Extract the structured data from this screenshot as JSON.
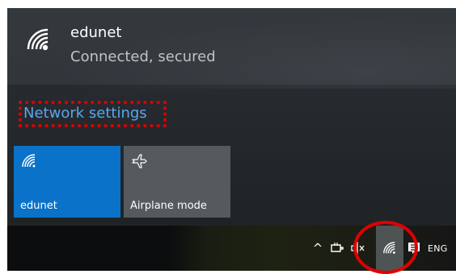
{
  "network": {
    "name": "edunet",
    "status": "Connected, secured",
    "icon": "wifi-secured-icon"
  },
  "settings": {
    "label": "Network settings"
  },
  "quick_actions": {
    "wifi": {
      "label": "edunet",
      "icon": "wifi-icon",
      "active": true
    },
    "airplane": {
      "label": "Airplane mode",
      "icon": "airplane-icon",
      "active": false
    }
  },
  "taskbar": {
    "chevron_icon": "chevron-up-icon",
    "power_icon": "power-icon",
    "volume_icon": "volume-muted-icon",
    "network_icon": "wifi-icon",
    "action_center_icon": "action-center-icon",
    "language": "ENG"
  },
  "annotations": {
    "highlight_color": "#e00000"
  },
  "colors": {
    "accent": "#0a72c9",
    "link": "#5aa6f0"
  }
}
